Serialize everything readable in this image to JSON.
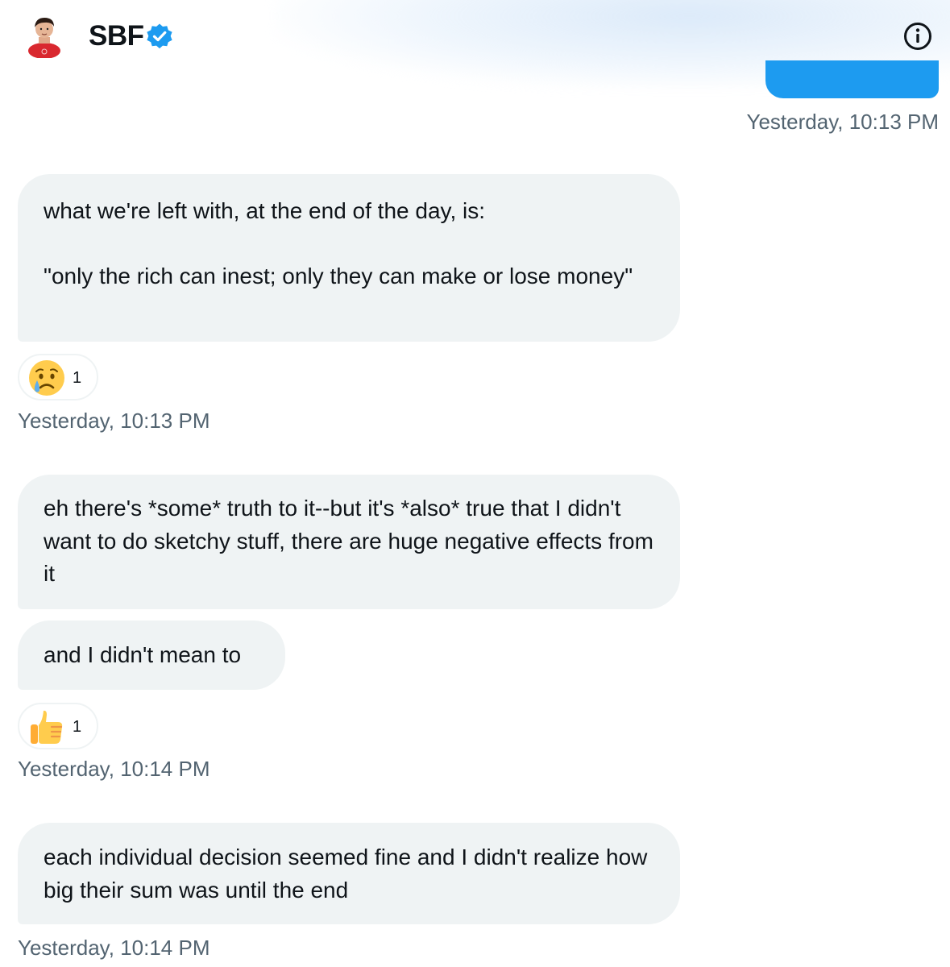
{
  "header": {
    "name": "SBF",
    "verified_icon": "verified-badge-icon",
    "info_icon": "info-icon",
    "colors": {
      "verified": "#1d9bf0",
      "sent_bubble": "#1d9bf0"
    }
  },
  "messages": [
    {
      "timestamp": "Yesterday, 10:13 PM",
      "direction": "sent"
    },
    {
      "direction": "received",
      "lines": [
        "what we're left with, at the end of the day, is:",
        "\"only the rich can inest; only they can make or lose money\""
      ],
      "reaction": {
        "emoji": "crying-face",
        "count": "1"
      },
      "timestamp": "Yesterday, 10:13 PM"
    },
    {
      "direction": "received",
      "text": "eh there's *some* truth to it--but it's *also* true that I didn't want to do sketchy stuff, there are huge negative effects from it"
    },
    {
      "direction": "received",
      "text": "and I didn't mean to",
      "reaction": {
        "emoji": "thumbs-up",
        "count": "1"
      },
      "timestamp": "Yesterday, 10:14 PM"
    },
    {
      "direction": "received",
      "text": "each individual decision seemed fine and I didn't realize how big their sum was until the end",
      "timestamp": "Yesterday, 10:14 PM"
    }
  ]
}
